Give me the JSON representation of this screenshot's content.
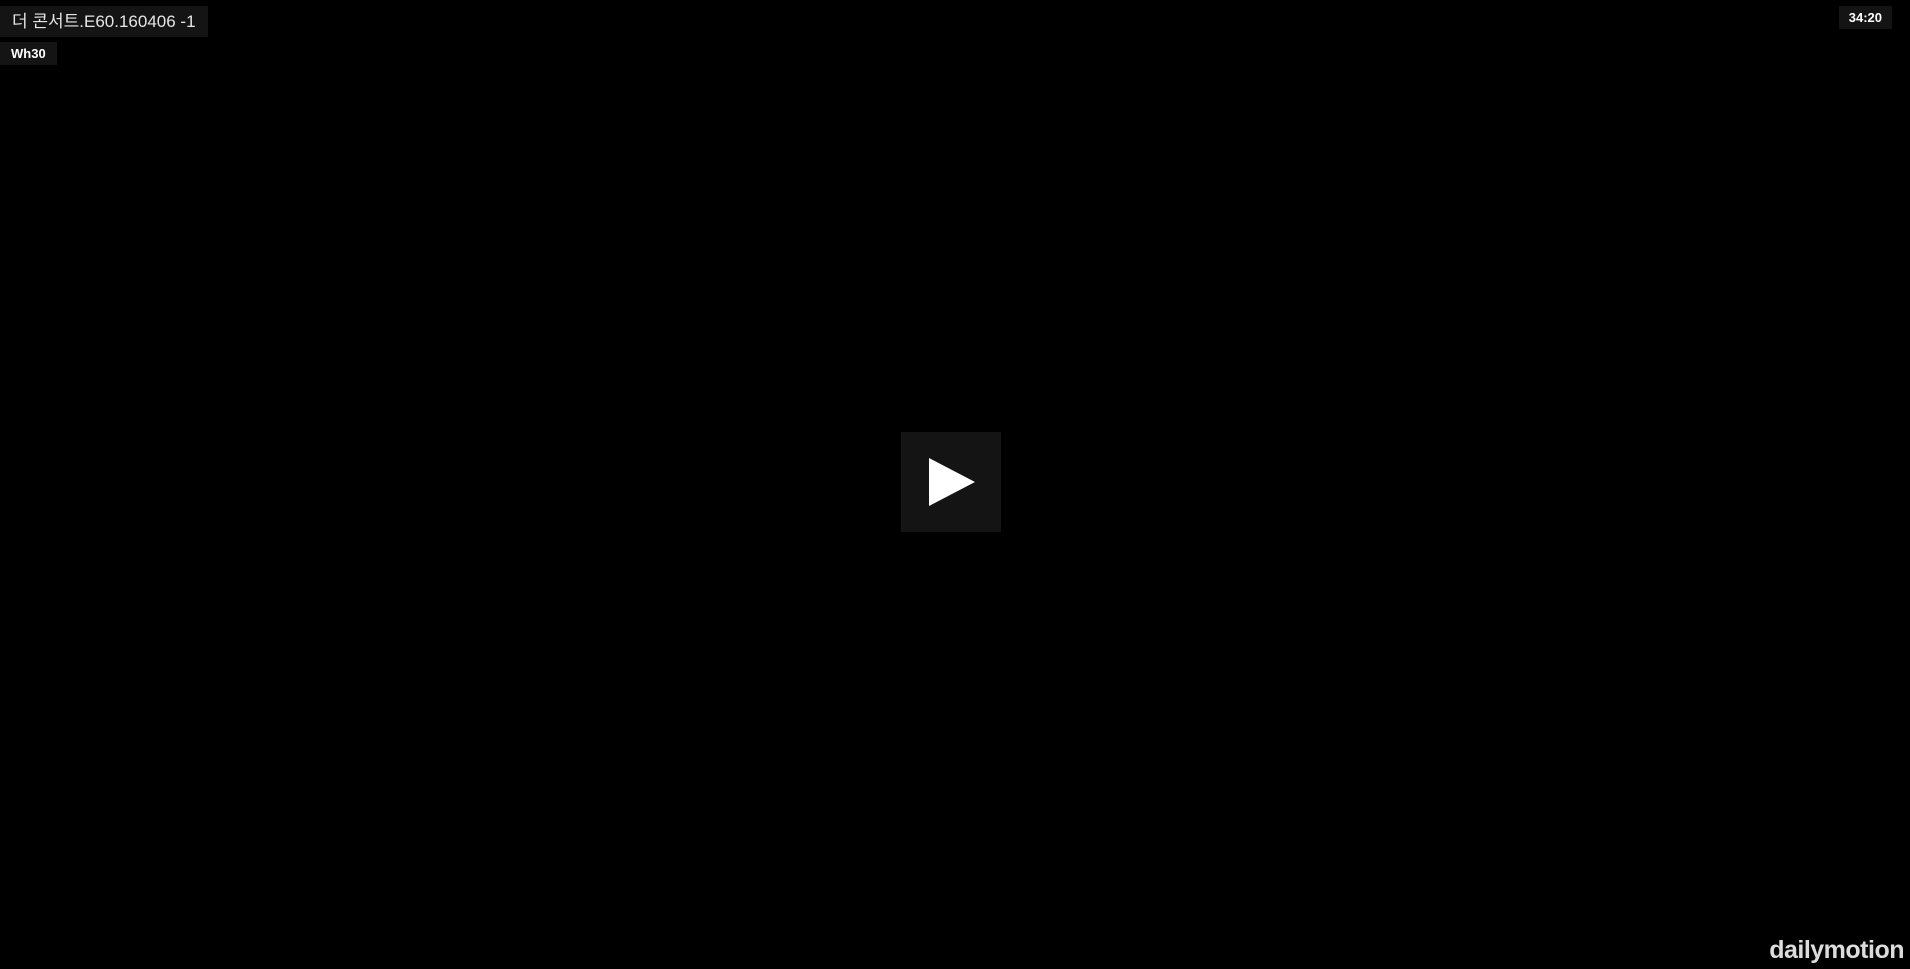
{
  "video": {
    "title": "더 콘서트.E60.160406 -1",
    "channel": "Wh30",
    "duration": "34:20"
  },
  "controls": {
    "play_icon": "play-icon"
  },
  "branding": {
    "logo_text": "dailymotion"
  },
  "colors": {
    "background": "#000000",
    "overlay": "#141414",
    "text": "#ffffff"
  }
}
